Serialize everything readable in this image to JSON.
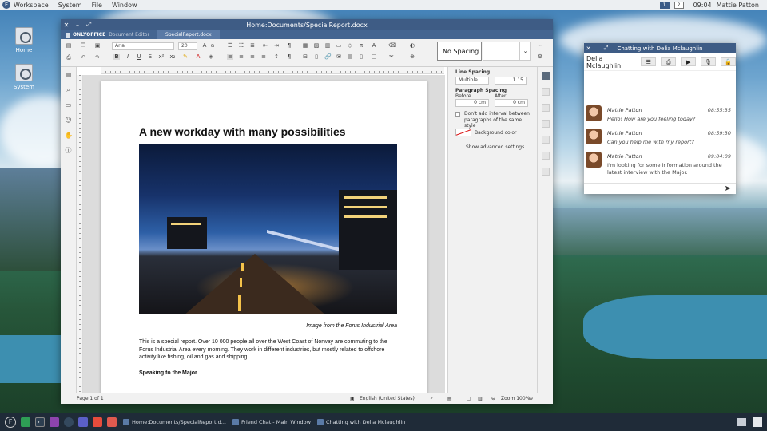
{
  "top_panel": {
    "app": "Workspace",
    "menus": [
      "System",
      "File",
      "Window"
    ],
    "workspaces": [
      "1",
      "2"
    ],
    "clock": "09:04",
    "user": "Mattie Patton"
  },
  "desktop_icons": [
    {
      "label": "Home"
    },
    {
      "label": "System"
    }
  ],
  "editor": {
    "window_title": "Home:Documents/SpecialReport.docx",
    "brand": "ONLYOFFICE",
    "brand_sub": "Document Editor",
    "doc_tab": "SpecialReport.docx",
    "toolbar": {
      "font_name": "Arial",
      "font_size": "20",
      "style_name": "No Spacing"
    },
    "document": {
      "heading": "A new workday with many possibilities",
      "caption": "Image from the Forus Industrial Area",
      "paragraph": "This is a special report. Over 10 000 people all over the West Coast of Norway are commuting to the Forus Industrial Area every morning. They work in different industries, but mostly related to offshore activity like fishing, oil and gas and shipping.",
      "subheading": "Speaking to the Major"
    },
    "paragraph_settings": {
      "line_spacing_label": "Line Spacing",
      "line_spacing_mode": "Multiple",
      "line_spacing_value": "1.15",
      "paragraph_spacing_label": "Paragraph Spacing",
      "before_label": "Before",
      "after_label": "After",
      "before_value": "0 cm",
      "after_value": "0 cm",
      "no_interval_label": "Don't add interval between paragraphs of the same style",
      "background_label": "Background color",
      "advanced_link": "Show advanced settings"
    },
    "status": {
      "page": "Page 1 of 1",
      "language": "English (United States)",
      "zoom": "Zoom 100%"
    }
  },
  "chat": {
    "window_title": "Chatting with Delia Mclaughlin",
    "contact": "Delia Mclaughlin",
    "messages": [
      {
        "author": "Mattie Patton",
        "time": "08:55:35",
        "text": "Hello! How are you feeling today?"
      },
      {
        "author": "Mattie Patton",
        "time": "08:59:30",
        "text": "Can you help me with my report?"
      },
      {
        "author": "Mattie Patton",
        "time": "09:04:09",
        "text": "I'm looking for some information around the latest interview with the Major."
      }
    ]
  },
  "taskbar": {
    "tasks": [
      "Home:Documents/SpecialReport.d...",
      "Friend Chat - Main Window",
      "Chatting with Delia Mclaughlin"
    ]
  }
}
